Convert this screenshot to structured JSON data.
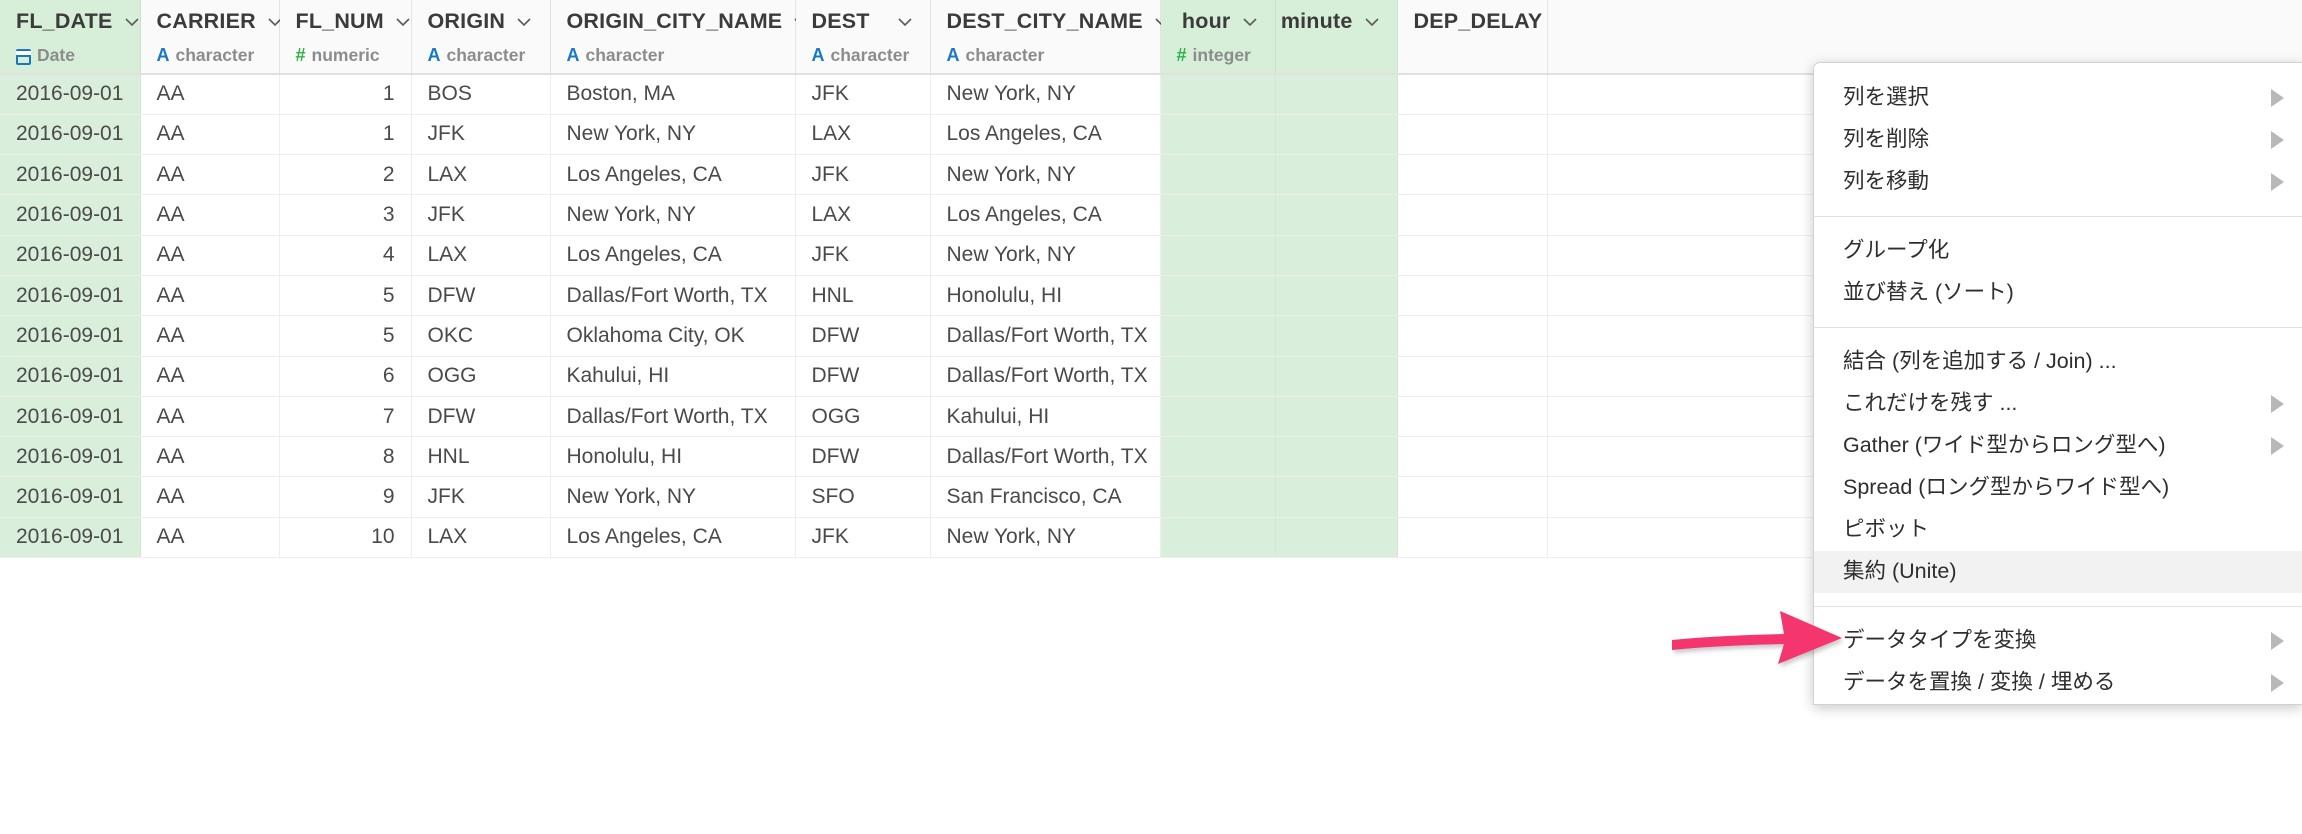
{
  "theme": {
    "selected_column_bg": "#d7efd9",
    "header_bg": "#fafafa",
    "annotation_arrow_color": "#f4356e",
    "menu_highlight_bg": "#f2f2f2",
    "type_char_color": "#1877c9",
    "type_number_color": "#2eb34a"
  },
  "table": {
    "columns": [
      {
        "name": "FL_DATE",
        "type": "Date",
        "type_glyph": "calendar-icon",
        "align": "left",
        "selected": true
      },
      {
        "name": "CARRIER",
        "type": "character",
        "type_glyph": "A",
        "align": "left",
        "selected": false
      },
      {
        "name": "FL_NUM",
        "type": "numeric",
        "type_glyph": "#",
        "align": "right",
        "selected": false
      },
      {
        "name": "ORIGIN",
        "type": "character",
        "type_glyph": "A",
        "align": "left",
        "selected": false
      },
      {
        "name": "ORIGIN_CITY_NAME",
        "type": "character",
        "type_glyph": "A",
        "align": "left",
        "selected": false
      },
      {
        "name": "DEST",
        "type": "character",
        "type_glyph": "A",
        "align": "left",
        "selected": false
      },
      {
        "name": "DEST_CITY_NAME",
        "type": "character",
        "type_glyph": "A",
        "align": "left",
        "selected": false
      },
      {
        "name": "hour",
        "type": "integer",
        "type_glyph": "#",
        "align": "right",
        "selected": true
      },
      {
        "name": "minute",
        "type": "",
        "type_glyph": "",
        "align": "right",
        "selected": true
      },
      {
        "name": "DEP_DELAY",
        "type": "",
        "type_glyph": "",
        "align": "right",
        "selected": false
      }
    ],
    "rows": [
      {
        "FL_DATE": "2016-09-01",
        "CARRIER": "AA",
        "FL_NUM": "1",
        "ORIGIN": "BOS",
        "ORIGIN_CITY_NAME": "Boston, MA",
        "DEST": "JFK",
        "DEST_CITY_NAME": "New York, NY"
      },
      {
        "FL_DATE": "2016-09-01",
        "CARRIER": "AA",
        "FL_NUM": "1",
        "ORIGIN": "JFK",
        "ORIGIN_CITY_NAME": "New York, NY",
        "DEST": "LAX",
        "DEST_CITY_NAME": "Los Angeles, CA"
      },
      {
        "FL_DATE": "2016-09-01",
        "CARRIER": "AA",
        "FL_NUM": "2",
        "ORIGIN": "LAX",
        "ORIGIN_CITY_NAME": "Los Angeles, CA",
        "DEST": "JFK",
        "DEST_CITY_NAME": "New York, NY"
      },
      {
        "FL_DATE": "2016-09-01",
        "CARRIER": "AA",
        "FL_NUM": "3",
        "ORIGIN": "JFK",
        "ORIGIN_CITY_NAME": "New York, NY",
        "DEST": "LAX",
        "DEST_CITY_NAME": "Los Angeles, CA"
      },
      {
        "FL_DATE": "2016-09-01",
        "CARRIER": "AA",
        "FL_NUM": "4",
        "ORIGIN": "LAX",
        "ORIGIN_CITY_NAME": "Los Angeles, CA",
        "DEST": "JFK",
        "DEST_CITY_NAME": "New York, NY"
      },
      {
        "FL_DATE": "2016-09-01",
        "CARRIER": "AA",
        "FL_NUM": "5",
        "ORIGIN": "DFW",
        "ORIGIN_CITY_NAME": "Dallas/Fort Worth, TX",
        "DEST": "HNL",
        "DEST_CITY_NAME": "Honolulu, HI"
      },
      {
        "FL_DATE": "2016-09-01",
        "CARRIER": "AA",
        "FL_NUM": "5",
        "ORIGIN": "OKC",
        "ORIGIN_CITY_NAME": "Oklahoma City, OK",
        "DEST": "DFW",
        "DEST_CITY_NAME": "Dallas/Fort Worth, TX"
      },
      {
        "FL_DATE": "2016-09-01",
        "CARRIER": "AA",
        "FL_NUM": "6",
        "ORIGIN": "OGG",
        "ORIGIN_CITY_NAME": "Kahului, HI",
        "DEST": "DFW",
        "DEST_CITY_NAME": "Dallas/Fort Worth, TX"
      },
      {
        "FL_DATE": "2016-09-01",
        "CARRIER": "AA",
        "FL_NUM": "7",
        "ORIGIN": "DFW",
        "ORIGIN_CITY_NAME": "Dallas/Fort Worth, TX",
        "DEST": "OGG",
        "DEST_CITY_NAME": "Kahului, HI"
      },
      {
        "FL_DATE": "2016-09-01",
        "CARRIER": "AA",
        "FL_NUM": "8",
        "ORIGIN": "HNL",
        "ORIGIN_CITY_NAME": "Honolulu, HI",
        "DEST": "DFW",
        "DEST_CITY_NAME": "Dallas/Fort Worth, TX"
      },
      {
        "FL_DATE": "2016-09-01",
        "CARRIER": "AA",
        "FL_NUM": "9",
        "ORIGIN": "JFK",
        "ORIGIN_CITY_NAME": "New York, NY",
        "DEST": "SFO",
        "DEST_CITY_NAME": "San Francisco, CA"
      },
      {
        "FL_DATE": "2016-09-01",
        "CARRIER": "AA",
        "FL_NUM": "10",
        "ORIGIN": "LAX",
        "ORIGIN_CITY_NAME": "Los Angeles, CA",
        "DEST": "JFK",
        "DEST_CITY_NAME": "New York, NY"
      }
    ]
  },
  "context_menu": {
    "groups": [
      {
        "items": [
          {
            "label": "列を選択",
            "submenu": true,
            "highlighted": false
          },
          {
            "label": "列を削除",
            "submenu": true,
            "highlighted": false
          },
          {
            "label": "列を移動",
            "submenu": true,
            "highlighted": false
          }
        ]
      },
      {
        "items": [
          {
            "label": "グループ化",
            "submenu": false,
            "highlighted": false
          },
          {
            "label": "並び替え (ソート)",
            "submenu": false,
            "highlighted": false
          }
        ]
      },
      {
        "items": [
          {
            "label": "結合 (列を追加する / Join) ...",
            "submenu": false,
            "highlighted": false
          },
          {
            "label": "これだけを残す ...",
            "submenu": true,
            "highlighted": false
          },
          {
            "label": "Gather (ワイド型からロング型へ)",
            "submenu": true,
            "highlighted": false
          },
          {
            "label": "Spread (ロング型からワイド型へ)",
            "submenu": false,
            "highlighted": false
          },
          {
            "label": "ピボット",
            "submenu": false,
            "highlighted": false
          },
          {
            "label": "集約 (Unite)",
            "submenu": false,
            "highlighted": true
          }
        ]
      },
      {
        "items": [
          {
            "label": "データタイプを変換",
            "submenu": true,
            "highlighted": false
          },
          {
            "label": "データを置換 / 変換 / 埋める",
            "submenu": true,
            "highlighted": false
          }
        ]
      }
    ]
  },
  "annotation": {
    "arrow": "pointer-arrow-right",
    "points_to": "集約 (Unite)"
  }
}
